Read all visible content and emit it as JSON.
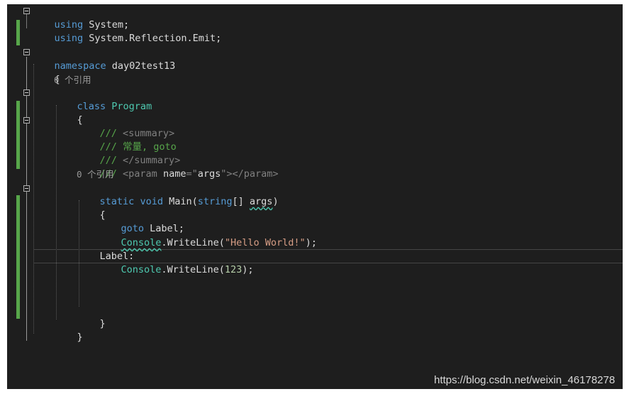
{
  "colors": {
    "background": "#1e1e1e",
    "keyword": "#569cd6",
    "type": "#4ec9b0",
    "comment": "#57a64a",
    "string": "#d69d85",
    "change_marker": "#57a64a"
  },
  "code": {
    "line1": {
      "kw": "using",
      "rest": " System;"
    },
    "line2": {
      "kw": "using",
      "rest": " System.Reflection.Emit;"
    },
    "line4": {
      "kw": "namespace",
      "rest": " day02test13"
    },
    "line5": {
      "text": "{"
    },
    "codelens1": "0 个引用",
    "line6": {
      "kw": "class",
      "type": "Program"
    },
    "line7": {
      "text": "{"
    },
    "doc1": {
      "prefix": "/// ",
      "tag": "<summary>"
    },
    "doc2": {
      "text": "/// 常量, goto"
    },
    "doc3": {
      "prefix": "/// ",
      "tag": "</summary>"
    },
    "doc4": {
      "prefix": "/// ",
      "tag_open": "<param ",
      "attr": "name",
      "eq": "=\"",
      "value": "args",
      "quote": "\"",
      "tag_close": "></param>"
    },
    "codelens2": "0 个引用",
    "line12": {
      "kw1": "static",
      "kw2": "void",
      "name": "Main(",
      "kw3": "string",
      "brackets": "[]",
      "param": "args",
      "close": ")"
    },
    "line13": {
      "text": "{"
    },
    "line14": {
      "kw": "goto",
      "rest": " Label;"
    },
    "line15": {
      "type": "Console",
      "method": ".WriteLine(",
      "str": "\"Hello World!\"",
      "close": ");"
    },
    "line16": {
      "text": "Label:"
    },
    "line17": {
      "type": "Console",
      "method": ".WriteLine(",
      "num": "123",
      "close": ");"
    },
    "line21": {
      "text": "}"
    },
    "line22": {
      "text": "}"
    },
    "line23": {
      "text": "}"
    }
  },
  "watermark": "https://blog.csdn.net/weixin_46178278"
}
